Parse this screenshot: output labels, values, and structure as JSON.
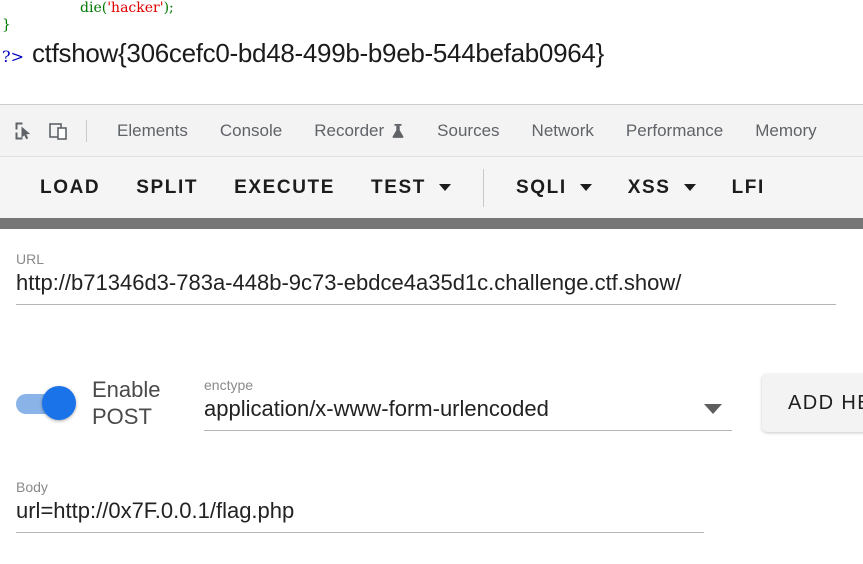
{
  "page": {
    "code_lines": [
      {
        "indent": true,
        "parts": [
          {
            "text": "die",
            "kind": "fn"
          },
          {
            "text": "(",
            "kind": "punc"
          },
          {
            "text": "'hacker'",
            "kind": "str"
          },
          {
            "text": ")",
            "kind": "punc"
          },
          {
            "text": ";",
            "kind": "punc"
          }
        ]
      },
      {
        "indent": false,
        "parts": [
          {
            "text": "}",
            "kind": "brace"
          }
        ]
      }
    ],
    "php_close_tag": "?>",
    "flag": "ctfshow{306cefc0-bd48-499b-b9eb-544befab0964}"
  },
  "devtools": {
    "inspect_icon": "inspect-element-icon",
    "device_icon": "device-toolbar-icon",
    "tabs": [
      {
        "label": "Elements",
        "icon": null
      },
      {
        "label": "Console",
        "icon": null
      },
      {
        "label": "Recorder",
        "icon": "flask-icon"
      },
      {
        "label": "Sources",
        "icon": null
      },
      {
        "label": "Network",
        "icon": null
      },
      {
        "label": "Performance",
        "icon": null
      },
      {
        "label": "Memory",
        "icon": null
      }
    ]
  },
  "hackbar": {
    "buttons": [
      {
        "label": "LOAD",
        "caret": false,
        "separator_before": false
      },
      {
        "label": "SPLIT",
        "caret": false,
        "separator_before": false
      },
      {
        "label": "EXECUTE",
        "caret": false,
        "separator_before": false
      },
      {
        "label": "TEST",
        "caret": true,
        "separator_before": false
      },
      {
        "label": "SQLI",
        "caret": true,
        "separator_before": true
      },
      {
        "label": "XSS",
        "caret": true,
        "separator_before": false
      },
      {
        "label": "LFI",
        "caret": false,
        "separator_before": false
      }
    ]
  },
  "form": {
    "url": {
      "label": "URL",
      "value": "http://b71346d3-783a-448b-9c73-ebdce4a35d1c.challenge.ctf.show/",
      "placeholder": "URL"
    },
    "post_toggle": {
      "label": "Enable POST",
      "enabled": true
    },
    "enctype": {
      "label": "enctype",
      "value": "application/x-www-form-urlencoded",
      "caret_icon": "chevron-down-icon"
    },
    "add_header_button": {
      "label": "ADD HEADER"
    },
    "body": {
      "label": "Body",
      "value": "url=http://0x7F.0.0.1/flag.php",
      "placeholder": "Body"
    }
  },
  "colors": {
    "accent_blue": "#1a73e8",
    "toggle_track": "#8ab4e8",
    "gray_bar": "#767676",
    "toolbar_bg": "#f5f5f5",
    "devtools_bg": "#f3f3f3",
    "code_green": "#007700",
    "code_red": "#dd0000",
    "php_tag_blue": "#0000bb"
  }
}
